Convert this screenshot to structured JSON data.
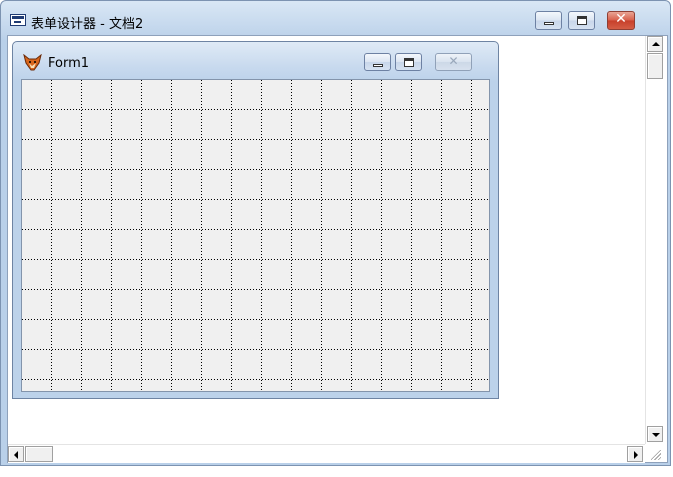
{
  "outer_window": {
    "title": "表单设计器 - 文档2",
    "icon": "form-designer-icon"
  },
  "form_window": {
    "title": "Form1",
    "icon": "fox-icon"
  },
  "colors": {
    "titlebar": "#c2d6ec",
    "close_button": "#d9614c",
    "canvas": "#f0f0f0"
  }
}
